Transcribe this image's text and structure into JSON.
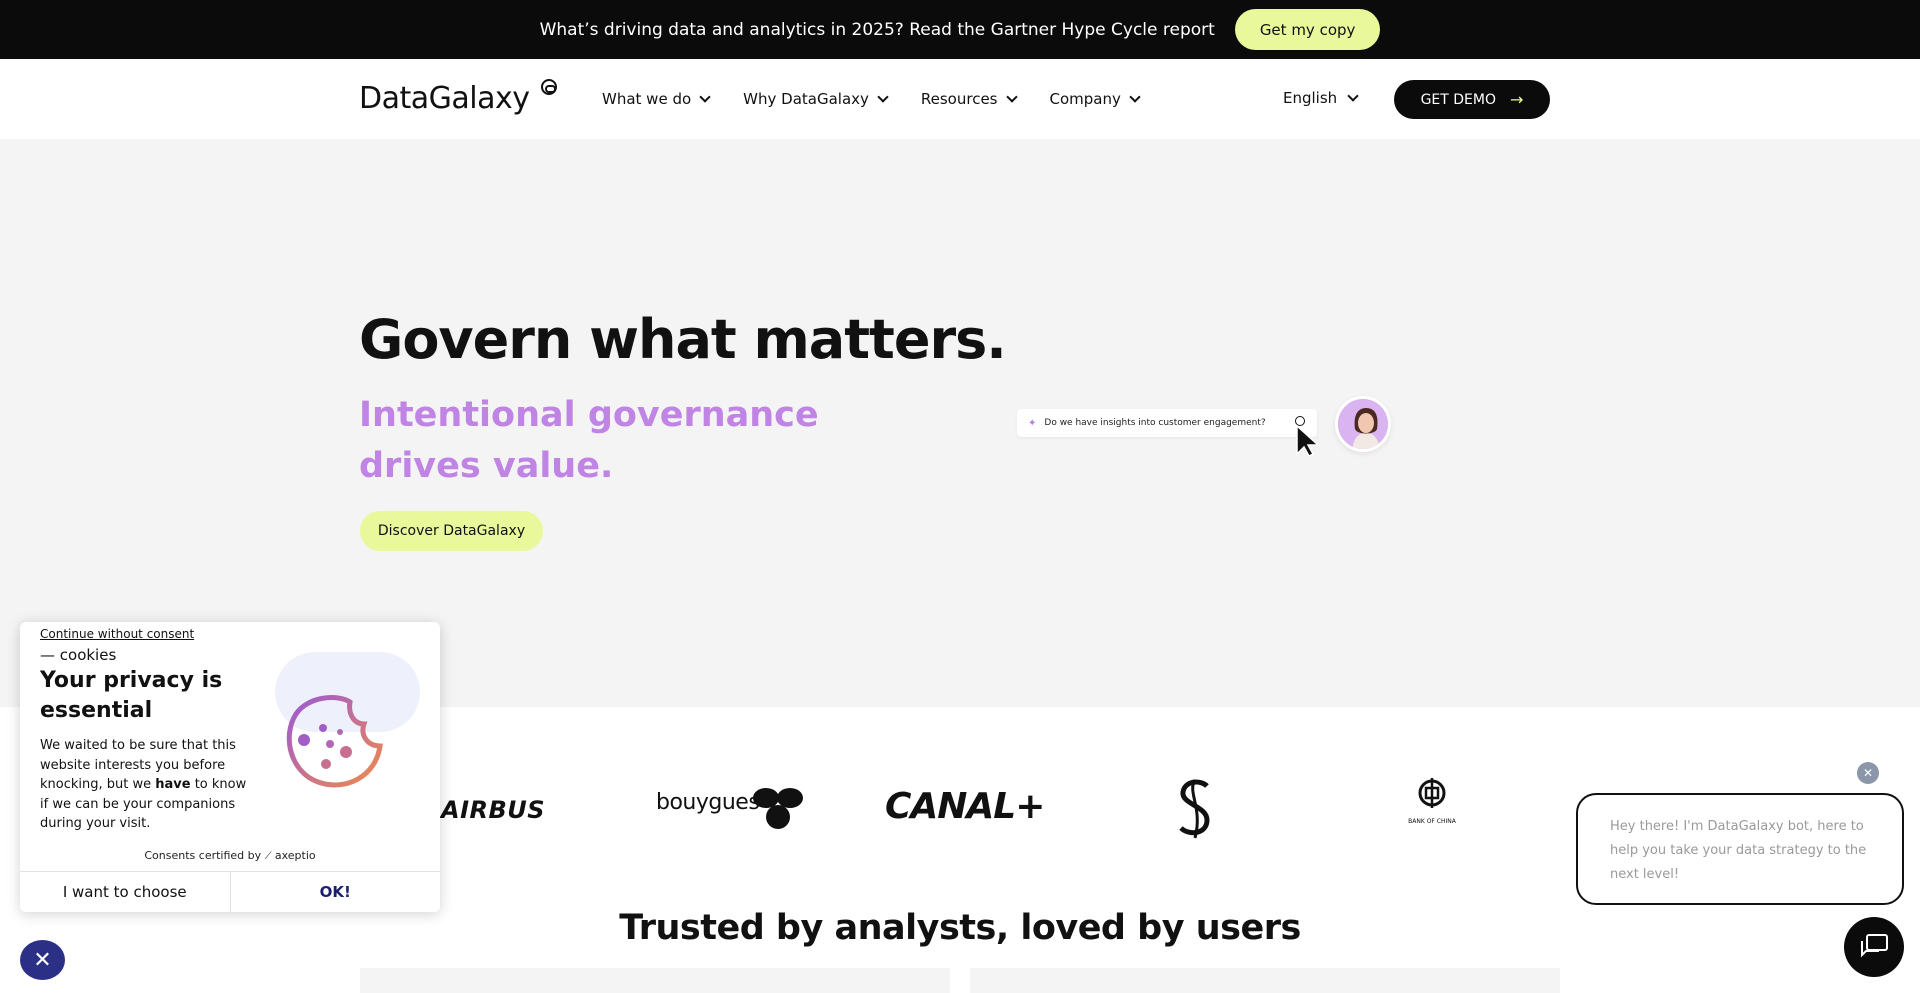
{
  "banner": {
    "text": "What’s driving data and analytics in 2025? Read the Gartner Hype Cycle report",
    "cta": "Get my copy"
  },
  "header": {
    "logo": "DataGalaxy",
    "nav": [
      {
        "label": "What we do"
      },
      {
        "label": "Why DataGalaxy"
      },
      {
        "label": "Resources"
      },
      {
        "label": "Company"
      }
    ],
    "language": "English",
    "demo_cta": "GET DEMO"
  },
  "hero": {
    "title": "Govern what matters.",
    "subtitle": "Intentional governance drives value.",
    "cta": "Discover DataGalaxy",
    "search_query": "Do we have insights into customer engagement?"
  },
  "logos": {
    "brands": [
      "AIRBUS",
      "bouygues",
      "CANAL+",
      "BANK OF CHINA"
    ]
  },
  "trusted_heading": "Trusted by analysts, loved by users",
  "cookie": {
    "continue_link": "Continue without consent",
    "eyebrow": "— cookies",
    "title": "Your privacy is essential",
    "body_1": "We waited to be sure that this website interests you before knocking, but we ",
    "body_bold": "have",
    "body_2": " to know if we can be your companions during your visit.",
    "certified": "Consents certified by",
    "certified_brand": "axeptio",
    "choose": "I want to choose",
    "ok": "OK!"
  },
  "chat": {
    "message": "Hey there! I'm DataGalaxy bot, here to help you take your data strategy to the next level!"
  },
  "colors": {
    "accent_lime": "#e8f89b",
    "accent_purple": "#c084e4",
    "dark": "#0b0b0b",
    "cookie_ok": "#1a1f6e"
  }
}
